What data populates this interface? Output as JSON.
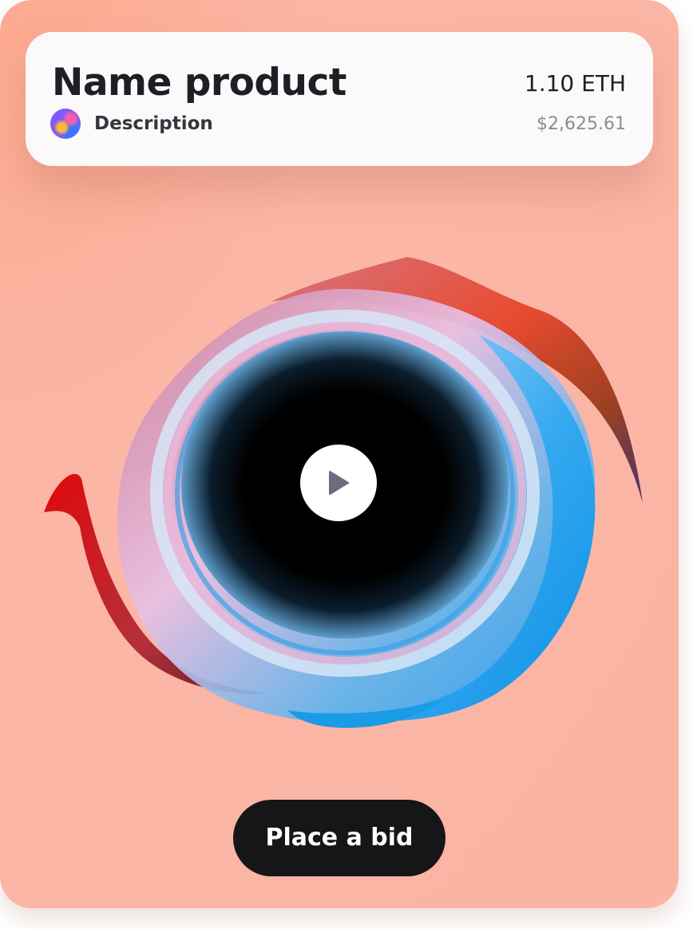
{
  "product": {
    "name": "Name product",
    "description": "Description",
    "price_eth": "1.10 ETH",
    "price_usd": "$2,625.61"
  },
  "media": {
    "play_icon": "play-icon",
    "artwork": "swirling-black-hole-artwork"
  },
  "actions": {
    "bid_label": "Place a bid"
  },
  "colors": {
    "card_background": "#fbb4a4",
    "panel_background": "#fbf9f9",
    "button_background": "#161618",
    "primary_text": "#1e1f26",
    "secondary_text": "#8b8c96"
  }
}
